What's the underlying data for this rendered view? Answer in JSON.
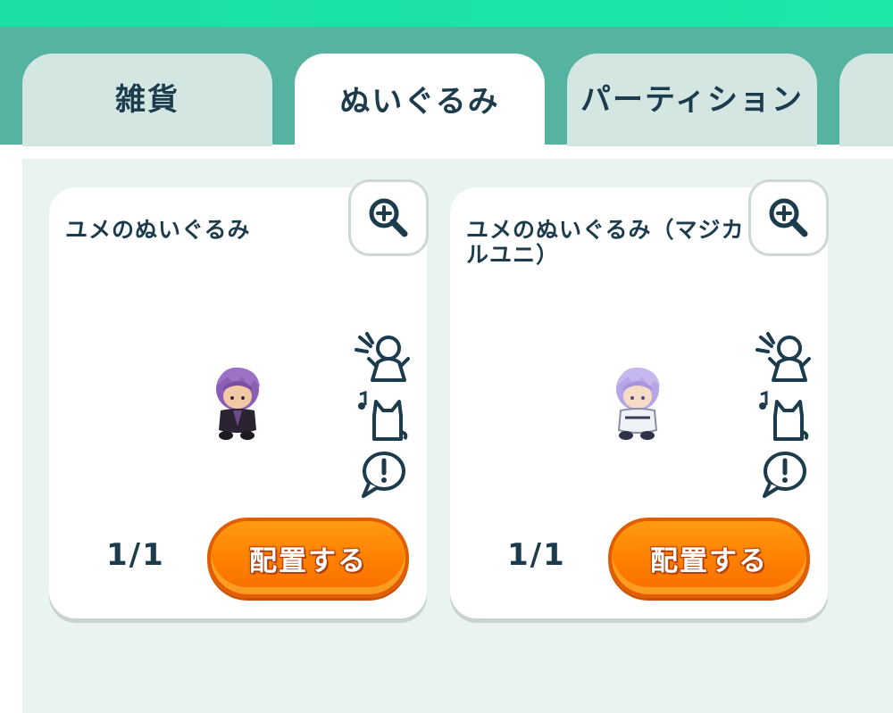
{
  "colors": {
    "header_gradient": "#1ee6a9",
    "tab_strip": "#56b3a2",
    "tab_inactive": "#d4e6e1",
    "text_dark": "#1c3b4c",
    "content_bg": "#e9f4ef",
    "button_orange": "#ff8a00"
  },
  "tabs": [
    {
      "label": "雑貨",
      "active": false
    },
    {
      "label": "ぬいぐるみ",
      "active": true
    },
    {
      "label": "パーティション",
      "active": false
    },
    {
      "label": "",
      "active": false
    }
  ],
  "cards": [
    {
      "title": "ユメのぬいぐるみ",
      "count": "1/1",
      "place_label": "配置する",
      "zoom_icon": "zoom-in-icon",
      "plush_color": "#8a5fb3",
      "feature_icons": [
        "spotlight-icon",
        "music-cat-icon",
        "speech-exclaim-icon"
      ]
    },
    {
      "title": "ユメのぬいぐるみ（マジカルユニ）",
      "count": "1/1",
      "place_label": "配置する",
      "zoom_icon": "zoom-in-icon",
      "plush_color": "#b7a6e6",
      "feature_icons": [
        "spotlight-icon",
        "music-cat-icon",
        "speech-exclaim-icon"
      ]
    }
  ]
}
